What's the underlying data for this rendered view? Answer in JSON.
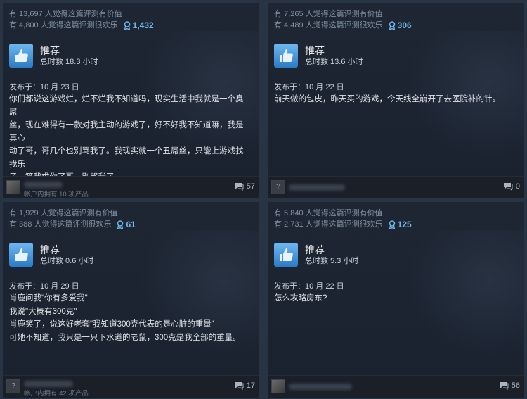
{
  "reviews": [
    {
      "helpful_text": "有 13,697 人觉得这篇评测有价值",
      "funny_text": "有 4,800 人觉得这篇评测很欢乐",
      "award_count": "1,432",
      "recommendation": "推荐",
      "hours": "总时数 18.3 小时",
      "posted": "发布于：10 月 23 日",
      "content": [
        "你们都说这游戏烂，烂不烂我不知道吗，现实生活中我就是一个臭屌",
        "丝，现在难得有一款对我主动的游戏了，好不好我不知道嘛，我是真心",
        "动了哥，哥几个也别骂我了。我现实就一个丑屌丝，只能上游戏找找乐",
        "子，算我求你了哥，别骂我了"
      ],
      "username": "",
      "owns": "帐户内拥有 10 项产品",
      "comments": "57"
    },
    {
      "helpful_text": "有 7,265 人觉得这篇评测有价值",
      "funny_text": "有 4,489 人觉得这篇评测很欢乐",
      "award_count": "306",
      "recommendation": "推荐",
      "hours": "总时数 13.6 小时",
      "posted": "发布于：10 月 22 日",
      "content": [
        "前天做的包皮，昨天买的游戏，今天线全崩开了去医院补的针。"
      ],
      "username": "",
      "owns": "",
      "comments": "0"
    },
    {
      "helpful_text": "有 1,929 人觉得这篇评测有价值",
      "funny_text": "有 388 人觉得这篇评测很欢乐",
      "award_count": "61",
      "recommendation": "推荐",
      "hours": "总时数 0.6 小时",
      "posted": "发布于：10 月 29 日",
      "content": [
        "肖鹿问我\"你有多爱我\"",
        "我说\"大概有300克\"",
        "肖鹿笑了，说这好老套\"我知道300克代表的是心脏的重量\"",
        "可她不知道，我只是一只下水道的老鼠，300克是我全部的重量。"
      ],
      "username": "",
      "owns": "帐户内拥有 42 项产品",
      "comments": "17"
    },
    {
      "helpful_text": "有 5,840 人觉得这篇评测有价值",
      "funny_text": "有 2,731 人觉得这篇评测很欢乐",
      "award_count": "125",
      "recommendation": "推荐",
      "hours": "总时数 5.3 小时",
      "posted": "发布于：10 月 22 日",
      "content": [
        "怎么攻略房东?"
      ],
      "username": "",
      "owns": "",
      "comments": "56"
    }
  ],
  "icons": {
    "award": "award-ribbon-icon",
    "thumb": "thumbs-up-icon",
    "comment": "comment-bubble-icon"
  },
  "colors": {
    "accent": "#6fb5ea",
    "thumb_top": "#6fb7f0",
    "thumb_bottom": "#2c7bc6"
  }
}
